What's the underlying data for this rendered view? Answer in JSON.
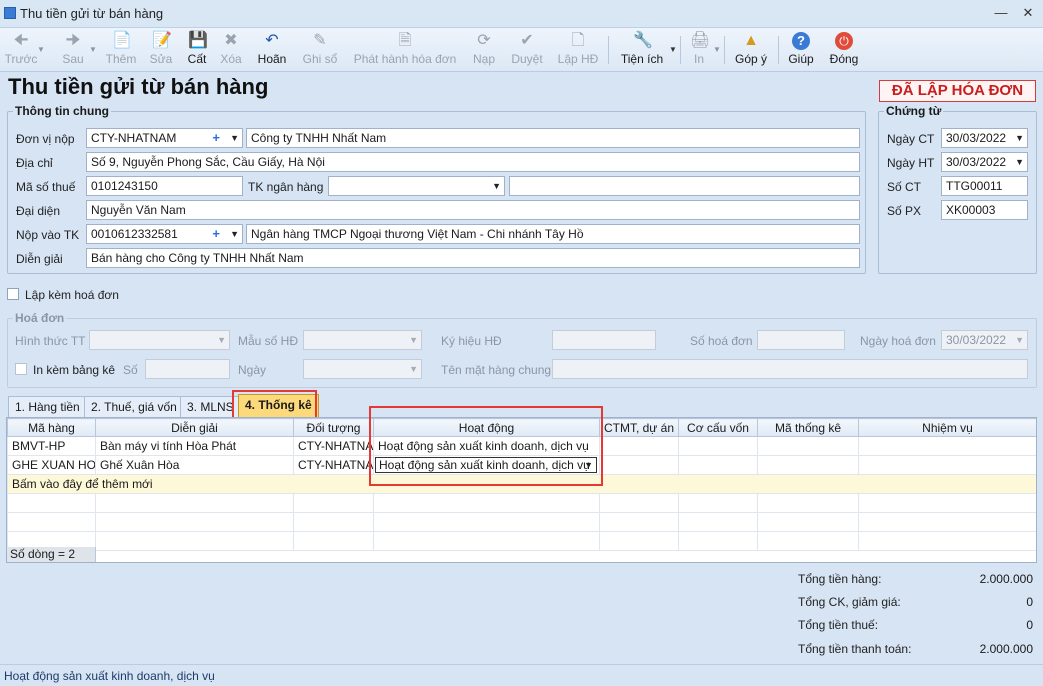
{
  "window": {
    "title": "Thu tiền gửi từ bán hàng"
  },
  "toolbar": [
    {
      "id": "prev",
      "label": "Trước",
      "icon": "arrow-left-icon",
      "enabled": false
    },
    {
      "id": "next",
      "label": "Sau",
      "icon": "arrow-right-icon",
      "enabled": false
    },
    {
      "id": "add",
      "label": "Thêm",
      "icon": "document-add-icon",
      "enabled": false
    },
    {
      "id": "edit",
      "label": "Sửa",
      "icon": "document-edit-icon",
      "enabled": false
    },
    {
      "id": "save",
      "label": "Cất",
      "icon": "save-icon",
      "enabled": true
    },
    {
      "id": "delete",
      "label": "Xóa",
      "icon": "delete-icon",
      "enabled": false
    },
    {
      "id": "undo",
      "label": "Hoãn",
      "icon": "undo-icon",
      "enabled": true
    },
    {
      "id": "post",
      "label": "Ghi sổ",
      "icon": "pencil-icon",
      "enabled": false
    },
    {
      "id": "issue_invoice",
      "label": "Phát hành hóa đơn",
      "icon": "invoice-icon",
      "enabled": false
    },
    {
      "id": "load",
      "label": "Nạp",
      "icon": "refresh-icon",
      "enabled": false
    },
    {
      "id": "approve",
      "label": "Duyệt",
      "icon": "check-icon",
      "enabled": false
    },
    {
      "id": "create_hd",
      "label": "Lập HĐ",
      "icon": "document-plus-icon",
      "enabled": false
    },
    {
      "id": "utilities",
      "label": "Tiện ích",
      "icon": "tools-icon",
      "enabled": true
    },
    {
      "id": "print",
      "label": "In",
      "icon": "printer-icon",
      "enabled": false
    },
    {
      "id": "feedback",
      "label": "Góp ý",
      "icon": "feedback-icon",
      "enabled": true
    },
    {
      "id": "help",
      "label": "Giúp",
      "icon": "help-icon",
      "enabled": true
    },
    {
      "id": "close",
      "label": "Đóng",
      "icon": "power-icon",
      "enabled": true
    }
  ],
  "page_title": "Thu tiền gửi từ bán hàng",
  "status_stamp": "ĐÃ LẬP HÓA ĐƠN",
  "general": {
    "legend": "Thông tin chung",
    "payer_label": "Đơn vị nộp",
    "payer_code": "CTY-NHATNAM",
    "payer_name": "Công ty TNHH Nhất Nam",
    "address_label": "Địa chỉ",
    "address": "Số 9, Nguyễn Phong Sắc, Cầu Giấy, Hà Nội",
    "tax_label": "Mã số thuế",
    "tax_code": "0101243150",
    "bank_label": "TK ngân hàng",
    "bank_account": "",
    "bank_name": "",
    "rep_label": "Đại diện",
    "representative": "Nguyễn Văn Nam",
    "deposit_label": "Nộp vào TK",
    "deposit_account": "0010612332581",
    "deposit_bank": "Ngân hàng TMCP Ngoại thương Việt Nam - Chi nhánh Tây Hồ",
    "desc_label": "Diễn giải",
    "description": "Bán hàng cho Công ty TNHH Nhất Nam"
  },
  "voucher": {
    "legend": "Chứng từ",
    "date_ct_label": "Ngày CT",
    "date_ct": "30/03/2022",
    "date_ht_label": "Ngày HT",
    "date_ht": "30/03/2022",
    "no_ct_label": "Số CT",
    "no_ct": "TTG00011",
    "no_px_label": "Số PX",
    "no_px": "XK00003"
  },
  "attach_invoice_label": "Lập kèm hoá đơn",
  "invoice": {
    "legend": "Hoá đơn",
    "payment_label": "Hình thức TT",
    "template_label": "Mẫu số HĐ",
    "symbol_label": "Ký hiệu HĐ",
    "number_label": "Số hoá đơn",
    "date_label": "Ngày hoá đơn",
    "date": "30/03/2022",
    "print_list_label": "In kèm bảng kê",
    "so_label": "Số",
    "ngay_label": "Ngày",
    "item_name_label": "Tên mặt hàng chung"
  },
  "tabs": [
    {
      "label": "1. Hàng tiền",
      "active": false
    },
    {
      "label": "2. Thuế, giá vốn",
      "active": false
    },
    {
      "label": "3. MLNS",
      "active": false
    },
    {
      "label": "4. Thống kê",
      "active": true
    }
  ],
  "grid": {
    "columns": [
      "Mã hàng",
      "Diễn giải",
      "Đối tượng",
      "Hoạt động",
      "CTMT, dự án",
      "Cơ cấu vốn",
      "Mã thống kê",
      "Nhiệm vụ"
    ],
    "rows": [
      [
        "BMVT-HP",
        "Bàn máy vi tính Hòa Phát",
        "CTY-NHATNAM",
        "Hoạt động sản xuất kinh doanh, dịch vụ",
        "",
        "",
        "",
        ""
      ],
      [
        "GHE XUAN HOA",
        "Ghế Xuân Hòa",
        "CTY-NHATNAM",
        "Hoạt động sản xuất kinh doanh, dịch vụ",
        "",
        "",
        "",
        ""
      ]
    ],
    "add_row_text": "Bấm vào đây để thêm mới",
    "row_count": "Số dòng = 2"
  },
  "totals": {
    "goods_label": "Tổng tiền hàng:",
    "goods": "2.000.000",
    "discount_label": "Tổng CK, giảm giá:",
    "discount": "0",
    "tax_label": "Tổng tiền thuế:",
    "tax": "0",
    "payment_label": "Tổng tiền thanh toán:",
    "payment": "2.000.000"
  },
  "status_bar": "Hoạt động sản xuất kinh doanh, dịch vụ",
  "colors": {
    "stamp": "#c81e1e",
    "active_tab": "#fcd97a",
    "highlight": "#e53935",
    "link_plus": "#2a6fd6"
  }
}
